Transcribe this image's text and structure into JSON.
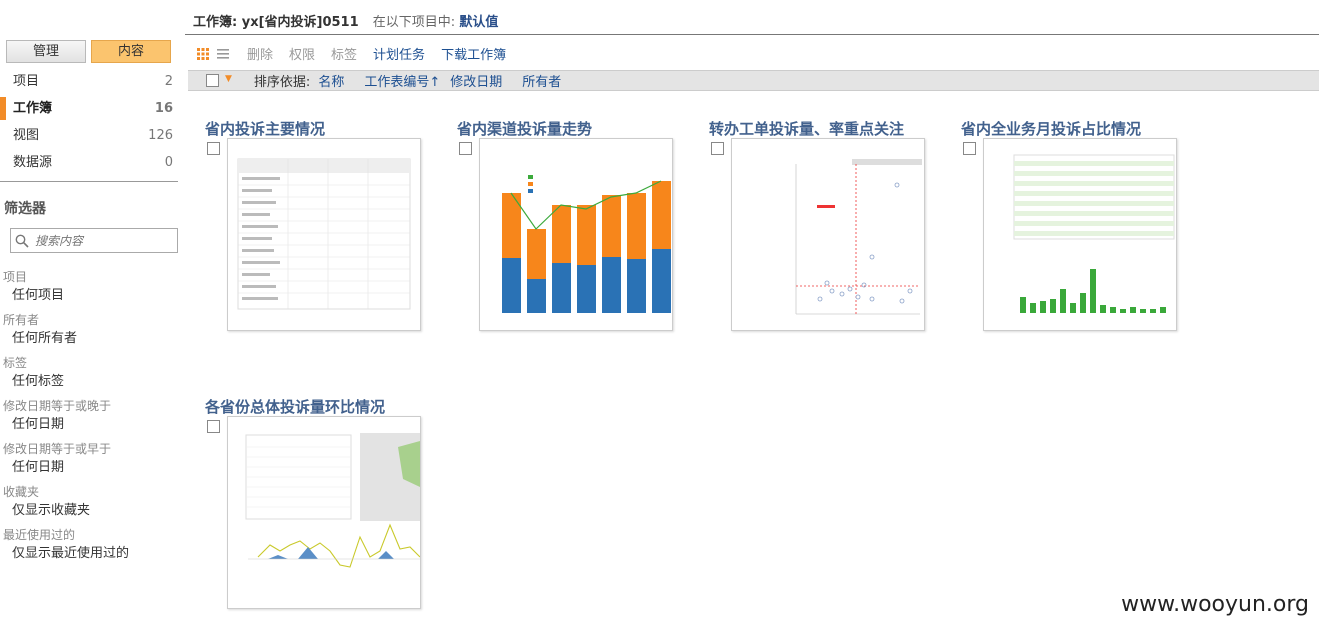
{
  "header": {
    "workbook_label": "工作簿: yx[省内投诉]0511",
    "in_project_label": "在以下项目中:",
    "project_name": "默认值"
  },
  "toggle": {
    "manage": "管理",
    "content": "内容"
  },
  "nav": [
    {
      "label": "项目",
      "count": "2"
    },
    {
      "label": "工作簿",
      "count": "16",
      "active": true
    },
    {
      "label": "视图",
      "count": "126"
    },
    {
      "label": "数据源",
      "count": "0"
    }
  ],
  "filter": {
    "title": "筛选器",
    "search_placeholder": "搜索内容",
    "groups": [
      {
        "label": "项目",
        "value": "任何项目"
      },
      {
        "label": "所有者",
        "value": "任何所有者"
      },
      {
        "label": "标签",
        "value": "任何标签"
      },
      {
        "label": "修改日期等于或晚于",
        "value": "任何日期"
      },
      {
        "label": "修改日期等于或早于",
        "value": "任何日期"
      },
      {
        "label": "收藏夹",
        "value": "仅显示收藏夹"
      },
      {
        "label": "最近使用过的",
        "value": "仅显示最近使用过的"
      }
    ]
  },
  "toolbar": {
    "delete": "删除",
    "permissions": "权限",
    "tags": "标签",
    "schedule": "计划任务",
    "download": "下载工作簿"
  },
  "sort": {
    "label": "排序依据:",
    "options": [
      "名称",
      "工作表编号↑",
      "修改日期",
      "所有者"
    ]
  },
  "cards": [
    {
      "title": "省内投诉主要情况",
      "thumb": "table"
    },
    {
      "title": "省内渠道投诉量走势",
      "thumb": "stacked-bar"
    },
    {
      "title": "转办工单投诉量、率重点关注",
      "thumb": "scatter"
    },
    {
      "title": "省内全业务月投诉占比情况",
      "thumb": "table-bar"
    },
    {
      "title": "各省份总体投诉量环比情况",
      "thumb": "map-line"
    }
  ],
  "watermark": "www.wooyun.org",
  "colors": {
    "accent": "#f28c28",
    "link": "#1d4f91",
    "title": "#42618d",
    "content_btn": "#fbc46e"
  }
}
